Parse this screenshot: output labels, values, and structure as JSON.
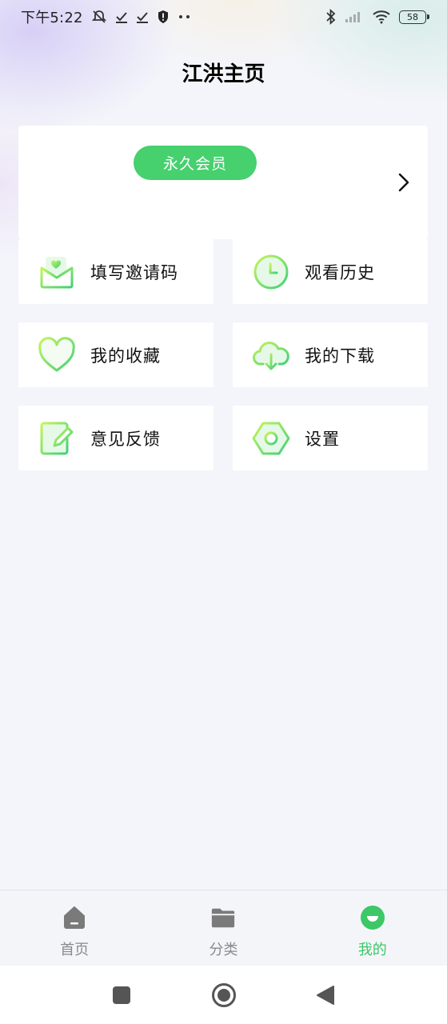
{
  "status_bar": {
    "time_prefix": "下午",
    "time": "5:22",
    "battery": "58",
    "icons": [
      "mute-bell-icon",
      "check-icon",
      "check-icon",
      "shield-alert-icon",
      "more-dots-icon",
      "bluetooth-icon",
      "signal-icon",
      "wifi-icon",
      "battery-icon"
    ]
  },
  "header": {
    "title": "江洪主页"
  },
  "member_card": {
    "badge": "永久会员",
    "arrow_icon": "chevron-right-icon"
  },
  "grid": {
    "items": [
      {
        "label": "填写邀请码",
        "icon": "invite-envelope-icon"
      },
      {
        "label": "观看历史",
        "icon": "clock-icon"
      },
      {
        "label": "我的收藏",
        "icon": "heart-icon"
      },
      {
        "label": "我的下载",
        "icon": "cloud-download-icon"
      },
      {
        "label": "意见反馈",
        "icon": "edit-note-icon"
      },
      {
        "label": "设置",
        "icon": "settings-hex-icon"
      }
    ]
  },
  "tab_bar": {
    "tabs": [
      {
        "label": "首页",
        "icon": "home-icon",
        "active": false
      },
      {
        "label": "分类",
        "icon": "folder-icon",
        "active": false
      },
      {
        "label": "我的",
        "icon": "smile-icon",
        "active": true
      }
    ]
  },
  "colors": {
    "accent": "#46d06e",
    "tab_active": "#3cc866",
    "tab_inactive": "#8a8a8a",
    "background": "#f4f5fa"
  }
}
